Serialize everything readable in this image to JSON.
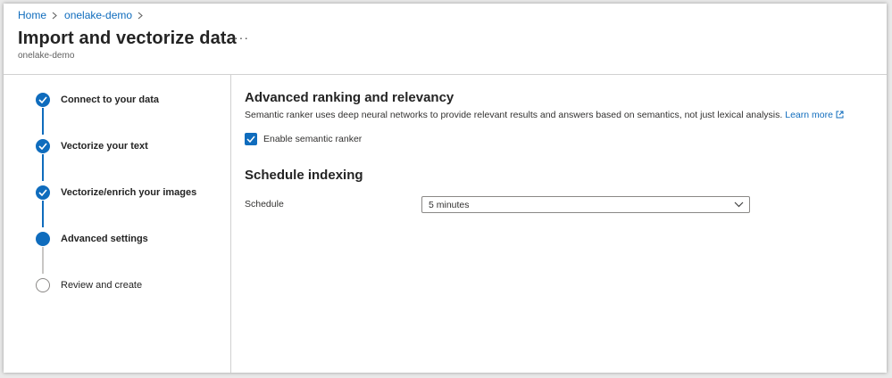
{
  "breadcrumb": {
    "items": [
      "Home",
      "onelake-demo"
    ]
  },
  "header": {
    "title": "Import and vectorize data",
    "subtitle": "onelake-demo",
    "more": "···"
  },
  "wizard": {
    "steps": [
      {
        "label": "Connect to your data",
        "status": "done"
      },
      {
        "label": "Vectorize your text",
        "status": "done"
      },
      {
        "label": "Vectorize/enrich your images",
        "status": "done"
      },
      {
        "label": "Advanced settings",
        "status": "current"
      },
      {
        "label": "Review and create",
        "status": "pending"
      }
    ]
  },
  "ranking": {
    "title": "Advanced ranking and relevancy",
    "description": "Semantic ranker uses deep neural networks to provide relevant results and answers based on semantics, not just lexical analysis.",
    "learn_more": "Learn more",
    "checkbox_label": "Enable semantic ranker",
    "checked": true
  },
  "schedule": {
    "title": "Schedule indexing",
    "label": "Schedule",
    "value": "5 minutes"
  },
  "colors": {
    "accent": "#0f6cbd",
    "pending": "#8a8886"
  }
}
